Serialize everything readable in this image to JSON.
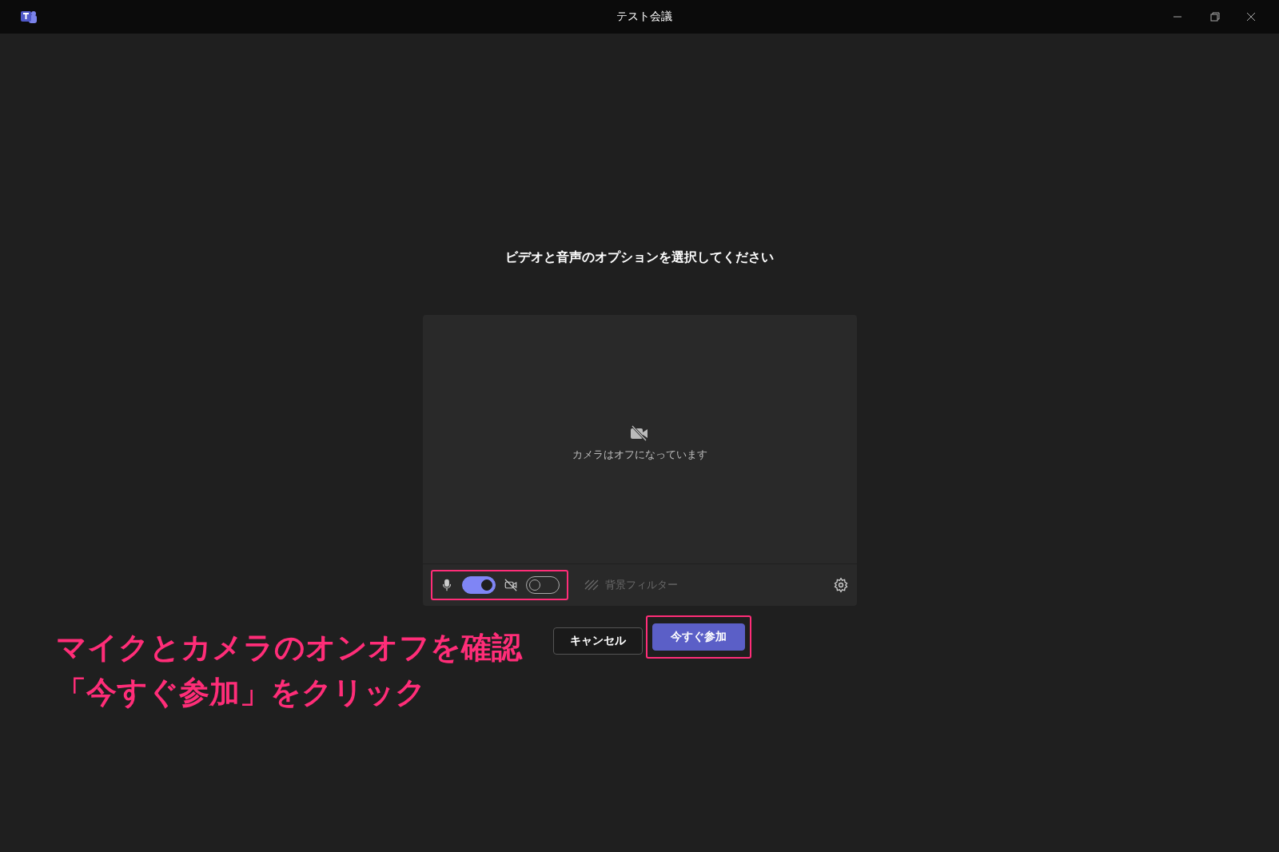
{
  "window": {
    "title": "テスト会議"
  },
  "heading": "ビデオと音声のオプションを選択してください",
  "preview": {
    "message": "カメラはオフになっています"
  },
  "toolbar": {
    "toggles": [
      {
        "kind": "mic",
        "on": true
      },
      {
        "kind": "camera",
        "on": false
      }
    ],
    "background_filter": {
      "label": "背景フィルター",
      "disabled": true
    }
  },
  "buttons": [
    {
      "label": "キャンセル",
      "kind": "secondary"
    },
    {
      "label": "今すぐ参加",
      "kind": "primary"
    }
  ],
  "annotation": [
    "マイクとカメラのオンオフを確認",
    "「今すぐ参加」をクリック"
  ]
}
